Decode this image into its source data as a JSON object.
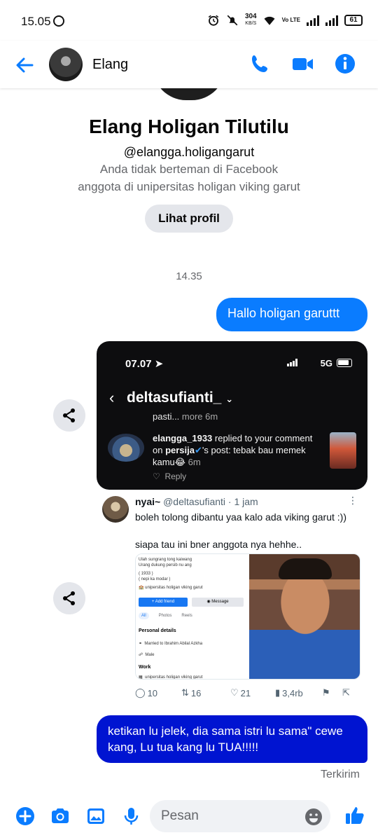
{
  "status_bar": {
    "time": "15.05",
    "speed_value": "304",
    "speed_unit": "KB/S",
    "volte": "Vo LTE",
    "battery": "61"
  },
  "header": {
    "contact_name": "Elang",
    "accent_color": "#0a7cff"
  },
  "profile": {
    "full_name": "Elang Holigan Tilutilu",
    "username": "@elangga.holigangarut",
    "relationship": "Anda tidak berteman di Facebook",
    "membership": "anggota di unipersitas holigan viking garut",
    "view_profile_label": "Lihat profil"
  },
  "thread": {
    "timestamp": "14.35",
    "message_1": "Hallo holigan garuttt",
    "message_2": "ketikan lu jelek, dia sama istri lu sama\" cewe kang, Lu tua kang lu TUA!!!!!",
    "sent_status": "Terkirim"
  },
  "image_1": {
    "phone_time": "07.07",
    "network": "5G",
    "username": "deltasufianti_",
    "prev_text": "pasti...",
    "prev_more": "more 6m",
    "notif_user": "elangga_1933",
    "notif_mid": " replied to your comment on ",
    "notif_target": "persija",
    "notif_rest": "'s post: tebak bau memek kamu😂",
    "notif_time": "6m",
    "reply_label": "Reply"
  },
  "tweet": {
    "display_name": "nyai~",
    "handle_time": " @deltasufianti · 1 jam",
    "line_1": "boleh tolong dibantu yaa kalo ada viking garut :))",
    "line_2": "siapa tau ini bner anggota nya hehhe..",
    "fb_intro_1": "Ulah sungrang tong kaiwang",
    "fb_intro_2": "Urang dukung persib nu ang",
    "fb_intro_3": "( 1933 )",
    "fb_intro_4": "( nepi ka modar )",
    "fb_school": "unipersitas holigan viking garut",
    "fb_add_friend": "Add friend",
    "fb_message": "Message",
    "fb_tab_all": "All",
    "fb_tab_photos": "Photos",
    "fb_tab_reels": "Reels",
    "fb_personal": "Personal details",
    "fb_married": "Married to Ibrahim Abilal Azkha",
    "fb_gender": "Male",
    "fb_work": "Work",
    "fb_work_item": "unipersitas holigan viking garut",
    "replies": "10",
    "retweets": "16",
    "likes": "21",
    "views": "3,4rb"
  },
  "composer": {
    "placeholder": "Pesan"
  },
  "icons": [
    "back-arrow-icon",
    "phone-icon",
    "video-icon",
    "info-icon",
    "share-icon",
    "plus-icon",
    "camera-icon",
    "image-icon",
    "mic-icon",
    "emoji-icon",
    "like-icon"
  ]
}
